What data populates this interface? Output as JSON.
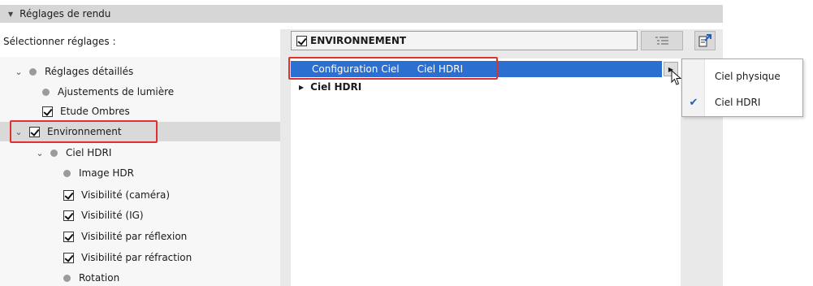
{
  "header": {
    "title": "Réglages de rendu",
    "collapse_icon": "triangle-down-icon"
  },
  "select_label": "Sélectionner réglages :",
  "tree": [
    {
      "label": "Réglages détaillés",
      "type": "dot",
      "expanded": true
    },
    {
      "label": "Ajustements de lumière",
      "type": "dot"
    },
    {
      "label": "Etude Ombres",
      "type": "checkbox",
      "checked": true
    },
    {
      "label": "Environnement",
      "type": "checkbox",
      "checked": true,
      "expanded": true,
      "selected": true
    },
    {
      "label": "Ciel HDRI",
      "type": "dot",
      "expanded": true
    },
    {
      "label": "Image HDR",
      "type": "dot"
    },
    {
      "label": "Visibilité (caméra)",
      "type": "checkbox",
      "checked": true
    },
    {
      "label": "Visibilité (IG)",
      "type": "checkbox",
      "checked": true
    },
    {
      "label": "Visibilité par réflexion",
      "type": "checkbox",
      "checked": true
    },
    {
      "label": "Visibilité par réfraction",
      "type": "checkbox",
      "checked": true
    },
    {
      "label": "Rotation",
      "type": "dot"
    }
  ],
  "panel": {
    "title": "ENVIRONNEMENT",
    "checked": true,
    "selected_row": {
      "label": "Configuration Ciel",
      "value": "Ciel HDRI"
    },
    "sub_section": "Ciel HDRI"
  },
  "toolbar": {
    "list_icon": "list-icon",
    "export_icon": "export-icon"
  },
  "dropdown": {
    "options": [
      {
        "label": "Ciel physique",
        "checked": false
      },
      {
        "label": "Ciel HDRI",
        "checked": true
      }
    ]
  },
  "colors": {
    "selection": "#2b6fd1",
    "highlight_border": "#e0312f",
    "header_bg": "#d6d6d6"
  }
}
